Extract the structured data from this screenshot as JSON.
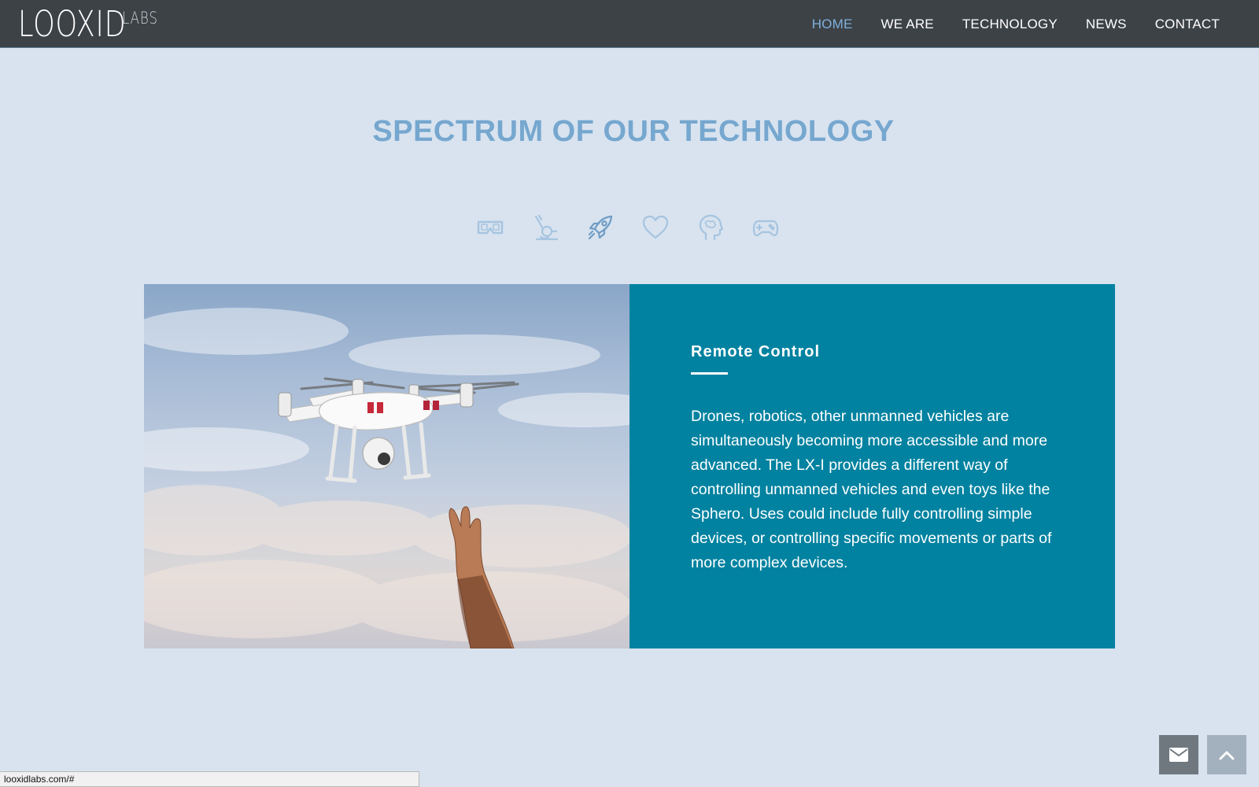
{
  "header": {
    "logo": {
      "main": "LOOXID",
      "sub": "LABS"
    },
    "nav": [
      {
        "label": "HOME",
        "active": true
      },
      {
        "label": "WE ARE",
        "active": false
      },
      {
        "label": "TECHNOLOGY",
        "active": false
      },
      {
        "label": "NEWS",
        "active": false
      },
      {
        "label": "CONTACT",
        "active": false
      }
    ]
  },
  "section": {
    "title": "SPECTRUM OF OUR TECHNOLOGY",
    "icons": [
      "vr-glasses-icon",
      "microscope-icon",
      "rocket-icon",
      "heart-icon",
      "brain-head-icon",
      "gamepad-icon"
    ],
    "active_icon": "rocket-icon"
  },
  "feature": {
    "heading": "Remote Control",
    "body": "Drones, robotics, other unmanned vehicles are simultaneously becoming more accessible and more advanced. The LX-I provides a different way of controlling unmanned vehicles and even toys like the Sphero. Uses could include fully controlling simple devices, or controlling specific movements or parts of more complex devices.",
    "image_subject": "drone-and-hand-photo"
  },
  "floating_buttons": {
    "mail": "envelope-icon",
    "top": "chevron-up-icon"
  },
  "status_bar": {
    "url": "looxidlabs.com/#"
  },
  "colors": {
    "header_bg": "#3d4247",
    "page_bg": "#d8e3ef",
    "accent": "#76a7cf",
    "nav_active": "#7fb0dc",
    "panel_bg": "#0082a0"
  }
}
